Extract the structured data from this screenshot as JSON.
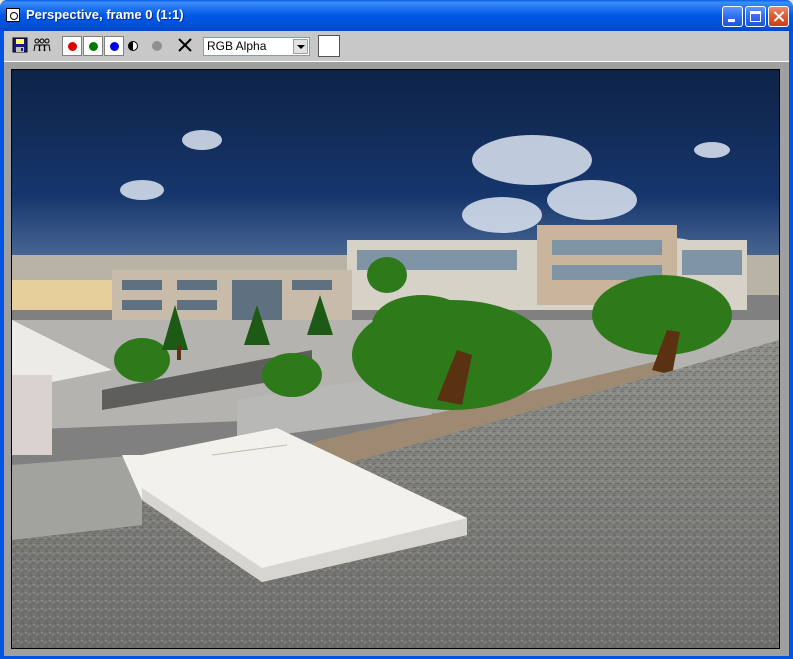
{
  "window": {
    "title": "Perspective, frame 0 (1:1)"
  },
  "title_buttons": {
    "minimize_icon": "minimize-icon",
    "maximize_icon": "maximize-icon",
    "close_icon": "close-icon"
  },
  "toolbar": {
    "tools": [
      {
        "name": "save-image",
        "icon": "save-icon"
      },
      {
        "name": "clone-window",
        "icon": "clone-icon"
      },
      {
        "name": "red-channel",
        "icon": "red-dot",
        "color": "#e00000"
      },
      {
        "name": "green-channel",
        "icon": "green-dot",
        "color": "#007a00"
      },
      {
        "name": "blue-channel",
        "icon": "blue-dot",
        "color": "#0000e0"
      },
      {
        "name": "monochrome",
        "icon": "half-circle-icon"
      },
      {
        "name": "alpha",
        "icon": "gray-dot"
      },
      {
        "name": "clear",
        "icon": "x-icon"
      }
    ],
    "channel_select": {
      "value": "RGB Alpha"
    },
    "background_swatch": "#ffffff"
  },
  "render": {
    "description_icon": "rendered-scene"
  },
  "colors": {
    "title_bar": "#0054e3",
    "toolbar": "#c8c8c8",
    "frame_bg": "#a0a0a0"
  }
}
